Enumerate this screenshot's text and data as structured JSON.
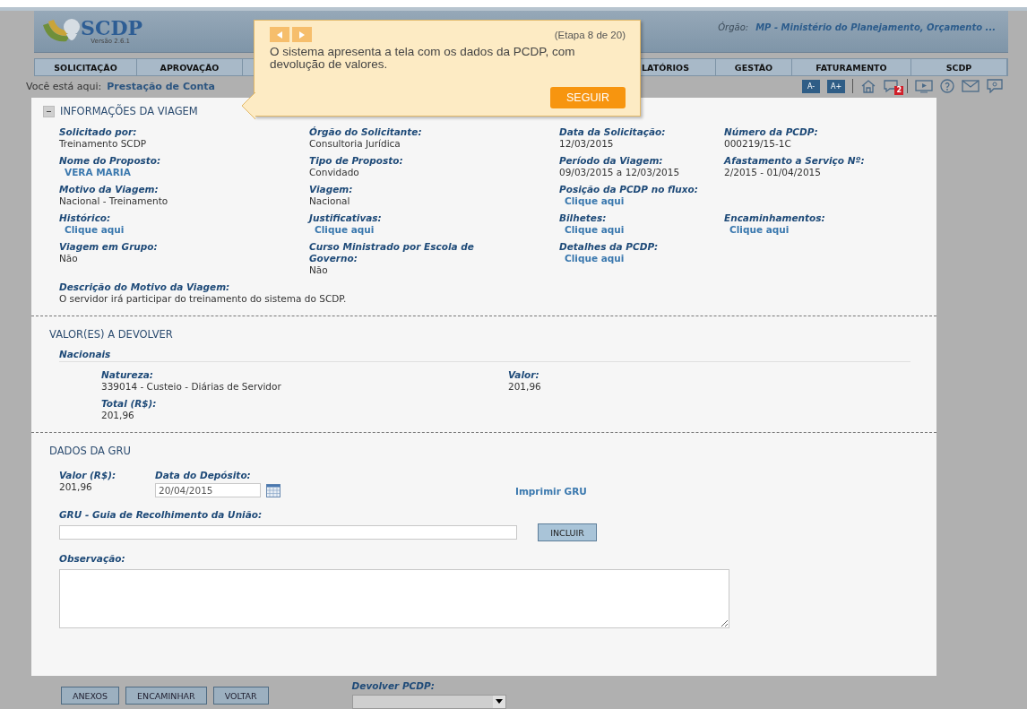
{
  "header": {
    "logo": "SCDP",
    "version": "Versão 2.6.1",
    "org_label": "Órgão:",
    "org_value": "MP - Ministério do Planejamento, Orçamento ..."
  },
  "menu": [
    "SOLICITAÇÃO",
    "APROVAÇÃO",
    "LATÓRIOS",
    "GESTÃO",
    "FATURAMENTO",
    "SCDP"
  ],
  "breadcrumb": {
    "label": "Você está aqui:",
    "current": "Prestação de Conta"
  },
  "toolbar": {
    "font_smaller": "A-",
    "font_larger": "A+",
    "messages_badge": "2"
  },
  "tour": {
    "step": "(Etapa 8 de 20)",
    "message": "O sistema apresenta a tela com os dados da PCDP, com devolução de valores.",
    "button": "SEGUIR"
  },
  "trip_info": {
    "title": "INFORMAÇÕES DA VIAGEM",
    "expanded": true,
    "rows": [
      [
        {
          "label": "Solicitado por:",
          "value": "Treinamento SCDP",
          "kind": "text"
        },
        {
          "label": "Órgão do Solicitante:",
          "value": "Consultoria Jurídica",
          "kind": "text"
        },
        {
          "label": "Data da Solicitação:",
          "value": "12/03/2015",
          "kind": "text"
        },
        {
          "label": "Número da PCDP:",
          "value": "000219/15-1C",
          "kind": "text"
        }
      ],
      [
        {
          "label": "Nome do Proposto:",
          "value": "VERA MARIA",
          "kind": "link"
        },
        {
          "label": "Tipo de Proposto:",
          "value": "Convidado",
          "kind": "text"
        },
        {
          "label": "Período da Viagem:",
          "value": "09/03/2015 a 12/03/2015",
          "kind": "text"
        },
        {
          "label": "Afastamento a Serviço Nº:",
          "value": "2/2015 - 01/04/2015",
          "kind": "text"
        }
      ],
      [
        {
          "label": "Motivo da Viagem:",
          "value": "Nacional - Treinamento",
          "kind": "text"
        },
        {
          "label": "Viagem:",
          "value": "Nacional",
          "kind": "text"
        },
        {
          "label": "Posição da PCDP no fluxo:",
          "value": "Clique aqui",
          "kind": "link"
        }
      ],
      [
        {
          "label": "Histórico:",
          "value": "Clique aqui",
          "kind": "link"
        },
        {
          "label": "Justificativas:",
          "value": "Clique aqui",
          "kind": "link"
        },
        {
          "label": "Bilhetes:",
          "value": "Clique aqui",
          "kind": "link"
        },
        {
          "label": "Encaminhamentos:",
          "value": "Clique aqui",
          "kind": "link"
        }
      ],
      [
        {
          "label": "Viagem em Grupo:",
          "value": "Não",
          "kind": "text"
        },
        {
          "label": "Curso Ministrado por Escola de Governo:",
          "value": "Não",
          "kind": "text"
        },
        {
          "label": "Detalhes da PCDP:",
          "value": "Clique aqui",
          "kind": "link"
        }
      ]
    ],
    "description": {
      "label": "Descrição do Motivo da Viagem:",
      "value": "O servidor irá participar do treinamento do sistema do SCDP."
    }
  },
  "refund": {
    "title": "VALOR(ES) A DEVOLVER",
    "group": "Nacionais",
    "nature_label": "Natureza:",
    "nature_value": "339014 - Custeio - Diárias de Servidor",
    "value_label": "Valor:",
    "value_value": "201,96",
    "total_label": "Total (R$):",
    "total_value": "201,96"
  },
  "gru": {
    "title": "DADOS DA GRU",
    "value_label": "Valor (R$):",
    "value": "201,96",
    "date_label": "Data do Depósito:",
    "date_value": "20/04/2015",
    "print_link": "Imprimir GRU",
    "gru_label": "GRU - Guia de Recolhimento da União:",
    "add_button": "INCLUIR",
    "note_label": "Observação:"
  },
  "actions": [
    "ANEXOS",
    "ENCAMINHAR",
    "VOLTAR"
  ],
  "return_select": {
    "label": "Devolver PCDP:"
  }
}
